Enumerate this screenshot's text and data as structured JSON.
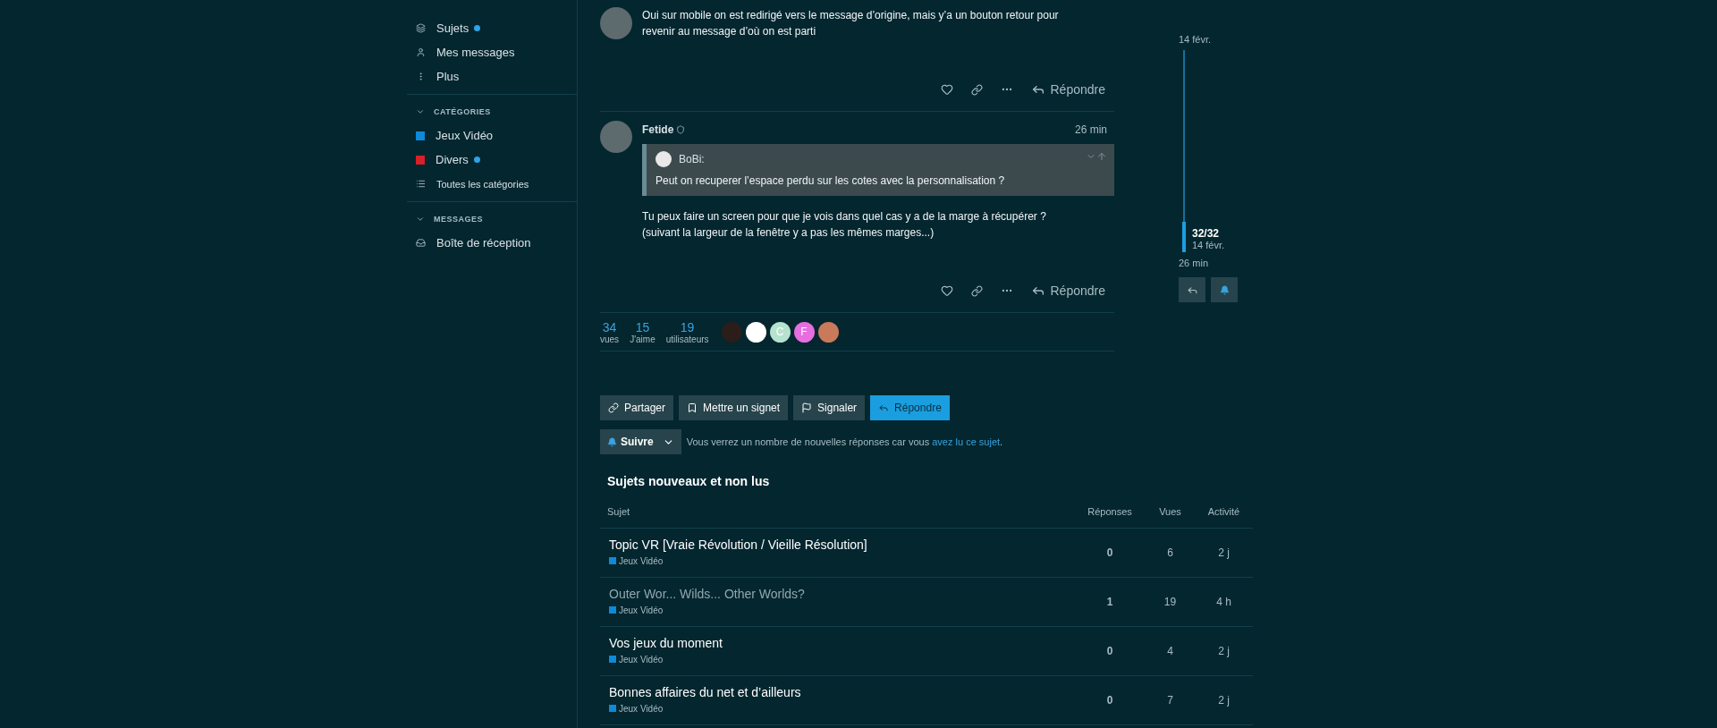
{
  "sidebar": {
    "items": [
      {
        "kind": "topics",
        "label": "Sujets",
        "unread": true
      },
      {
        "kind": "profile",
        "label": "Mes messages",
        "unread": false
      },
      {
        "kind": "more",
        "label": "Plus",
        "unread": false
      }
    ],
    "sections": [
      {
        "title": "CATÉGORIES",
        "expanded": true,
        "items": [
          {
            "kind": "category",
            "label": "Jeux Vidéo",
            "color": "#0e8ad8",
            "unread": false
          },
          {
            "kind": "category",
            "label": "Divers",
            "color": "#d72027",
            "unread": true
          },
          {
            "kind": "all",
            "label": "Toutes les catégories",
            "unread": false
          }
        ]
      },
      {
        "title": "MESSAGES",
        "expanded": true,
        "items": [
          {
            "kind": "inbox",
            "label": "Boîte de réception",
            "unread": false
          }
        ]
      }
    ]
  },
  "posts": [
    {
      "body": [
        "Oui sur mobile on est redirigé vers le message d’origine, mais y’a un bouton retour pour",
        "revenir au message d’où on est parti"
      ],
      "reply_label": "Répondre"
    },
    {
      "author": "Fetide",
      "time": "26 min",
      "quote": {
        "author": "BoBi:",
        "text": "Peut on recuperer l’espace perdu sur les cotes avec la personnalisation ?"
      },
      "body": [
        "Tu peux faire un screen pour que je vois dans quel cas y a de la marge à récupérer ?",
        "(suivant la largeur de la fenêtre y a pas les mêmes marges...)"
      ],
      "reply_label": "Répondre"
    }
  ],
  "stats": [
    {
      "value": "34",
      "label": "vues"
    },
    {
      "value": "15",
      "label": "J'aime"
    },
    {
      "value": "19",
      "label": "utilisateurs"
    }
  ],
  "participants": [
    {
      "color": "#2a1d1a"
    },
    {
      "color": "#ffffff"
    },
    {
      "letter": "C",
      "color": "#b5e3cf"
    },
    {
      "letter": "F",
      "color": "#e66ee0"
    },
    {
      "color": "#c97a5a"
    }
  ],
  "timeline": {
    "start": "14 févr.",
    "position": "32/32",
    "position_date": "14 févr.",
    "end": "26 min",
    "level": 0.15
  },
  "actions": [
    {
      "kind": "share",
      "label": "Partager",
      "primary": false
    },
    {
      "kind": "bookmark",
      "label": "Mettre un signet",
      "primary": false
    },
    {
      "kind": "flag",
      "label": "Signaler",
      "primary": false
    },
    {
      "kind": "reply",
      "label": "Répondre",
      "primary": true
    }
  ],
  "notification": {
    "label": "Suivre",
    "text": "Vous verrez un nombre de nouvelles réponses car vous ",
    "link": "avez lu ce sujet",
    "after": "."
  },
  "suggested": {
    "title": "Sujets nouveaux et non lus",
    "columns": [
      "Sujet",
      "Réponses",
      "Vues",
      "Activité"
    ],
    "rows": [
      {
        "title": "Topic VR [Vraie Révolution / Vieille Résolution]",
        "category": "Jeux Vidéo",
        "visited": false,
        "replies": "0",
        "views": "6",
        "activity": "2 j"
      },
      {
        "title": "Outer Wor... Wilds... Other Worlds?",
        "category": "Jeux Vidéo",
        "visited": true,
        "replies": "1",
        "views": "19",
        "activity": "4 h"
      },
      {
        "title": "Vos jeux du moment",
        "category": "Jeux Vidéo",
        "visited": false,
        "replies": "0",
        "views": "4",
        "activity": "2 j"
      },
      {
        "title": "Bonnes affaires du net et d’ailleurs",
        "category": "Jeux Vidéo",
        "visited": false,
        "replies": "0",
        "views": "7",
        "activity": "2 j"
      }
    ]
  }
}
